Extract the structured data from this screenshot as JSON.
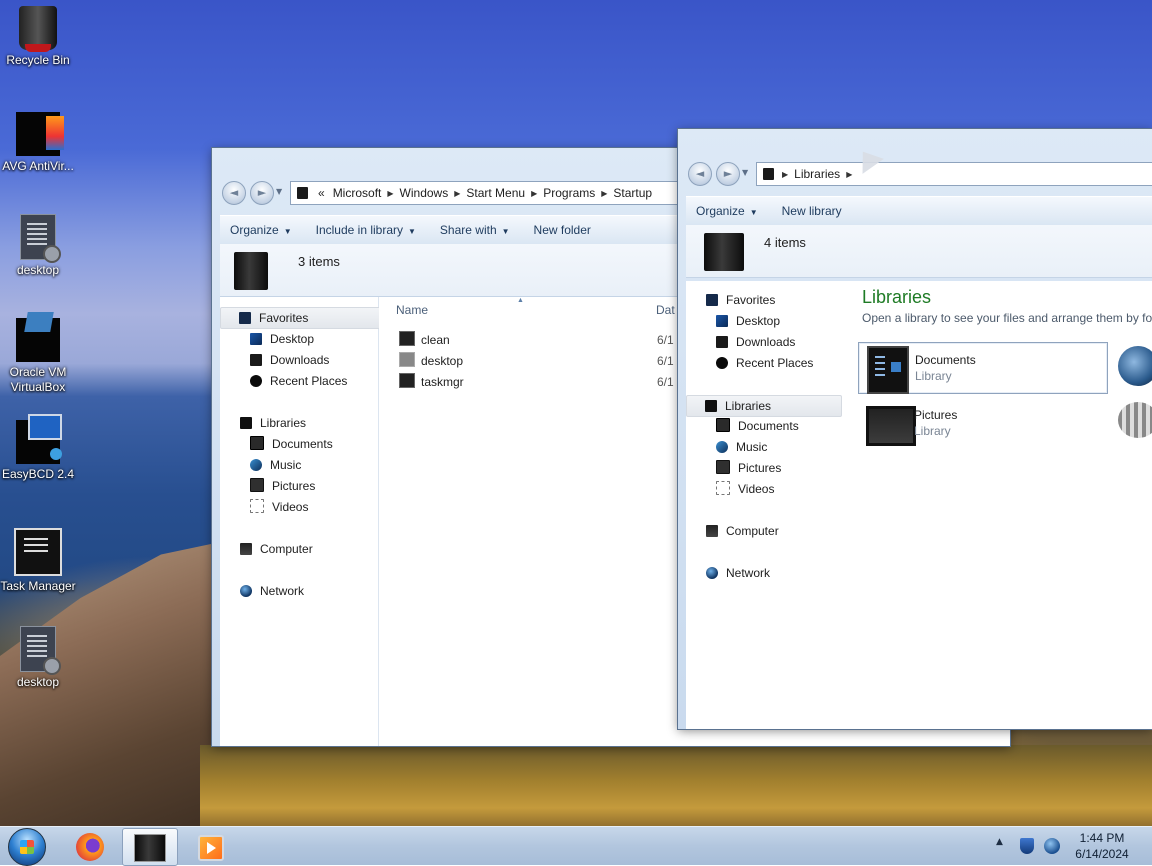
{
  "desktop": {
    "icons": [
      {
        "label": "Recycle Bin"
      },
      {
        "label": "AVG AntiVir..."
      },
      {
        "label": "desktop"
      },
      {
        "label": "Oracle VM VirtualBox"
      },
      {
        "label": "EasyBCD 2.4"
      },
      {
        "label": "Task Manager"
      },
      {
        "label": "desktop"
      }
    ]
  },
  "win1": {
    "nav_back": "◄",
    "nav_forward": "►",
    "address": [
      "«",
      "Microsoft",
      "Windows",
      "Start Menu",
      "Programs",
      "Startup"
    ],
    "toolbar": [
      "Organize",
      "Include in library",
      "Share with",
      "New folder"
    ],
    "item_count": "3 items",
    "nav": {
      "favorites": "Favorites",
      "fav_items": [
        "Desktop",
        "Downloads",
        "Recent Places"
      ],
      "libraries": "Libraries",
      "lib_items": [
        "Documents",
        "Music",
        "Pictures",
        "Videos"
      ],
      "computer": "Computer",
      "network": "Network"
    },
    "columns": {
      "name": "Name",
      "date": "Dat"
    },
    "files": [
      {
        "name": "clean",
        "date": "6/1"
      },
      {
        "name": "desktop",
        "date": "6/1"
      },
      {
        "name": "taskmgr",
        "date": "6/1"
      }
    ]
  },
  "win2": {
    "address": [
      "Libraries"
    ],
    "toolbar": [
      "Organize",
      "New library"
    ],
    "item_count": "4 items",
    "nav": {
      "favorites": "Favorites",
      "fav_items": [
        "Desktop",
        "Downloads",
        "Recent Places"
      ],
      "libraries": "Libraries",
      "lib_items": [
        "Documents",
        "Music",
        "Pictures",
        "Videos"
      ],
      "computer": "Computer",
      "network": "Network"
    },
    "title": "Libraries",
    "subtitle": "Open a library to see your files and arrange them by fol",
    "tiles": [
      {
        "name": "Documents",
        "type": "Library"
      },
      {
        "name": "Pictures",
        "type": "Library"
      }
    ]
  },
  "taskbar": {
    "time": "1:44 PM",
    "date": "6/14/2024",
    "tray_arrow": "▲"
  }
}
